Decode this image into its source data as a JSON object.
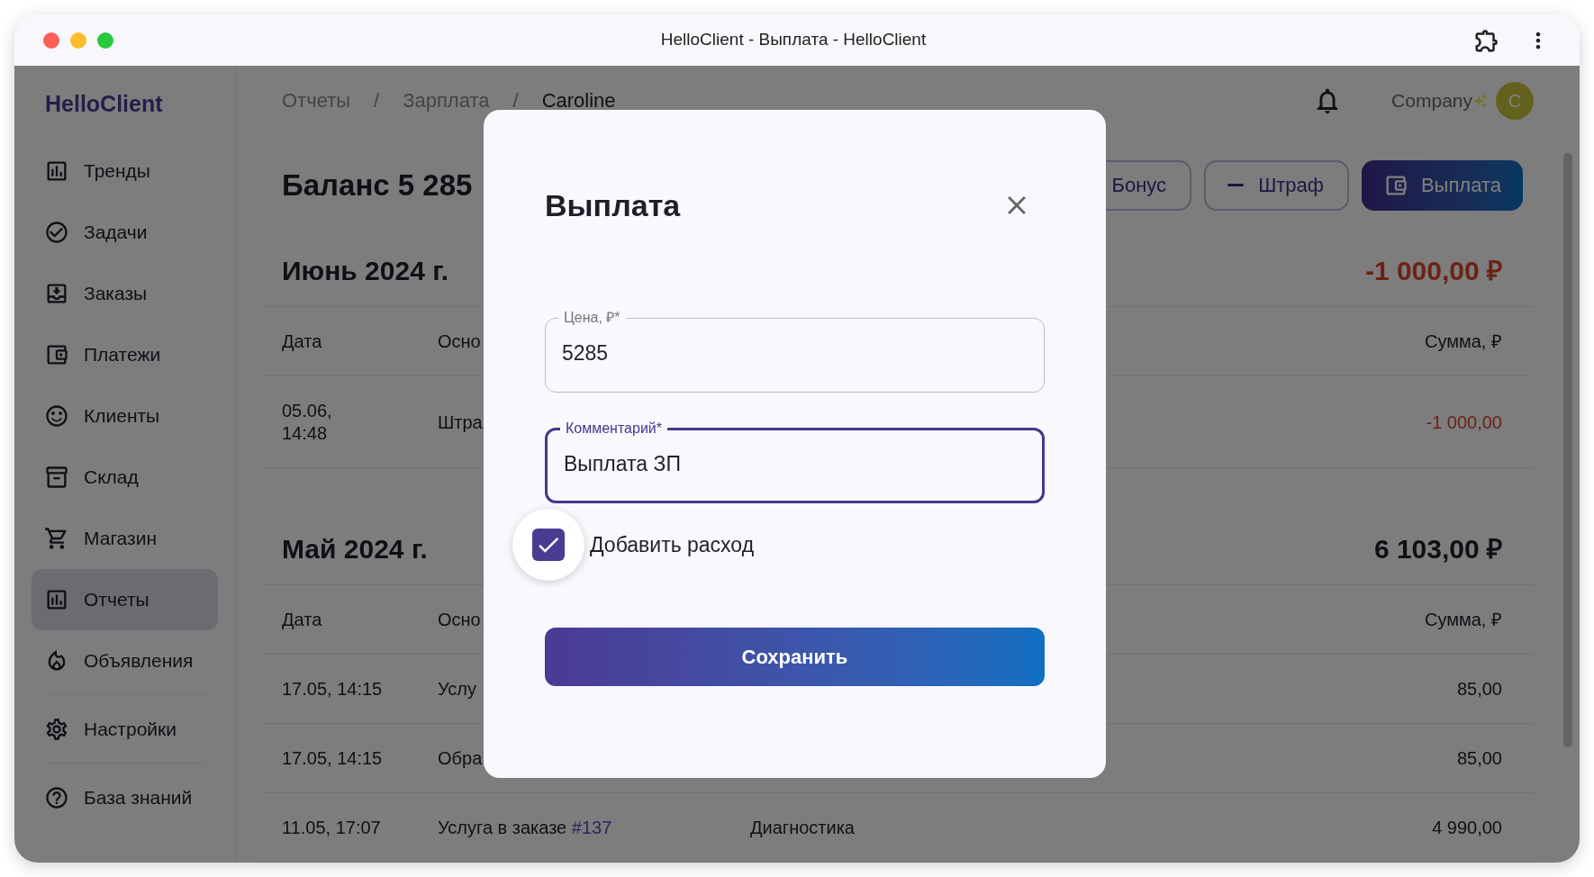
{
  "window": {
    "title": "HelloClient - Выплата - HelloClient"
  },
  "sidebar": {
    "brand": "HelloClient",
    "sections": [
      [
        {
          "label": "Тренды",
          "selected": false
        },
        {
          "label": "Задачи",
          "selected": false
        },
        {
          "label": "Заказы",
          "selected": false
        },
        {
          "label": "Платежи",
          "selected": false
        },
        {
          "label": "Клиенты",
          "selected": false
        },
        {
          "label": "Склад",
          "selected": false
        },
        {
          "label": "Магазин",
          "selected": false
        },
        {
          "label": "Отчеты",
          "selected": true
        },
        {
          "label": "Объявления",
          "selected": false
        }
      ],
      [
        {
          "label": "Настройки",
          "selected": false
        }
      ],
      [
        {
          "label": "База знаний",
          "selected": false
        }
      ]
    ]
  },
  "header": {
    "breadcrumbs": [
      {
        "text": "Отчеты",
        "kind": "link"
      },
      {
        "text": "/",
        "kind": "separator"
      },
      {
        "text": "Зарплата",
        "kind": "link"
      },
      {
        "text": "/",
        "kind": "separator"
      },
      {
        "text": "Caroline",
        "kind": "current"
      }
    ],
    "company": "Company",
    "avatar": "C"
  },
  "balance": {
    "title": "Баланс 5 285",
    "buttons": [
      {
        "label": "Бонус",
        "kind": "outline"
      },
      {
        "label": "Штраф",
        "kind": "outline"
      },
      {
        "label": "Выплата",
        "kind": "primary"
      }
    ]
  },
  "months": [
    {
      "title": "Июнь 2024 г.",
      "total": "-1 000,00 ₽",
      "negative": true,
      "columns": [
        "Дата",
        "Осно",
        "Сумма, ₽"
      ],
      "rows": [
        {
          "date": "05.06,\n14:48",
          "basis": "Штра",
          "amount": "-1 000,00",
          "negative": true
        }
      ]
    },
    {
      "title": "Май 2024 г.",
      "total": "6 103,00 ₽",
      "negative": false,
      "columns": [
        "Дата",
        "Осно",
        "Сумма, ₽"
      ],
      "rows": [
        {
          "date": "17.05, 14:15",
          "basis": "Услу",
          "amount": "85,00",
          "negative": false
        },
        {
          "date": "17.05, 14:15",
          "basis": "Обра",
          "amount": "85,00",
          "negative": false
        },
        {
          "date": "11.05, 17:07",
          "basis": "Услуга в заказе",
          "link": "#137",
          "comment": "Диагностика",
          "amount": "4 990,00",
          "negative": false
        }
      ]
    }
  ],
  "modal": {
    "title": "Выплата",
    "fields": [
      {
        "label": "Цена, ₽*",
        "value": "5285",
        "focused": false
      },
      {
        "label": "Комментарий*",
        "value": "Выплата ЗП",
        "focused": true
      }
    ],
    "checkbox": {
      "label": "Добавить расход",
      "checked": true
    },
    "save": "Сохранить"
  }
}
